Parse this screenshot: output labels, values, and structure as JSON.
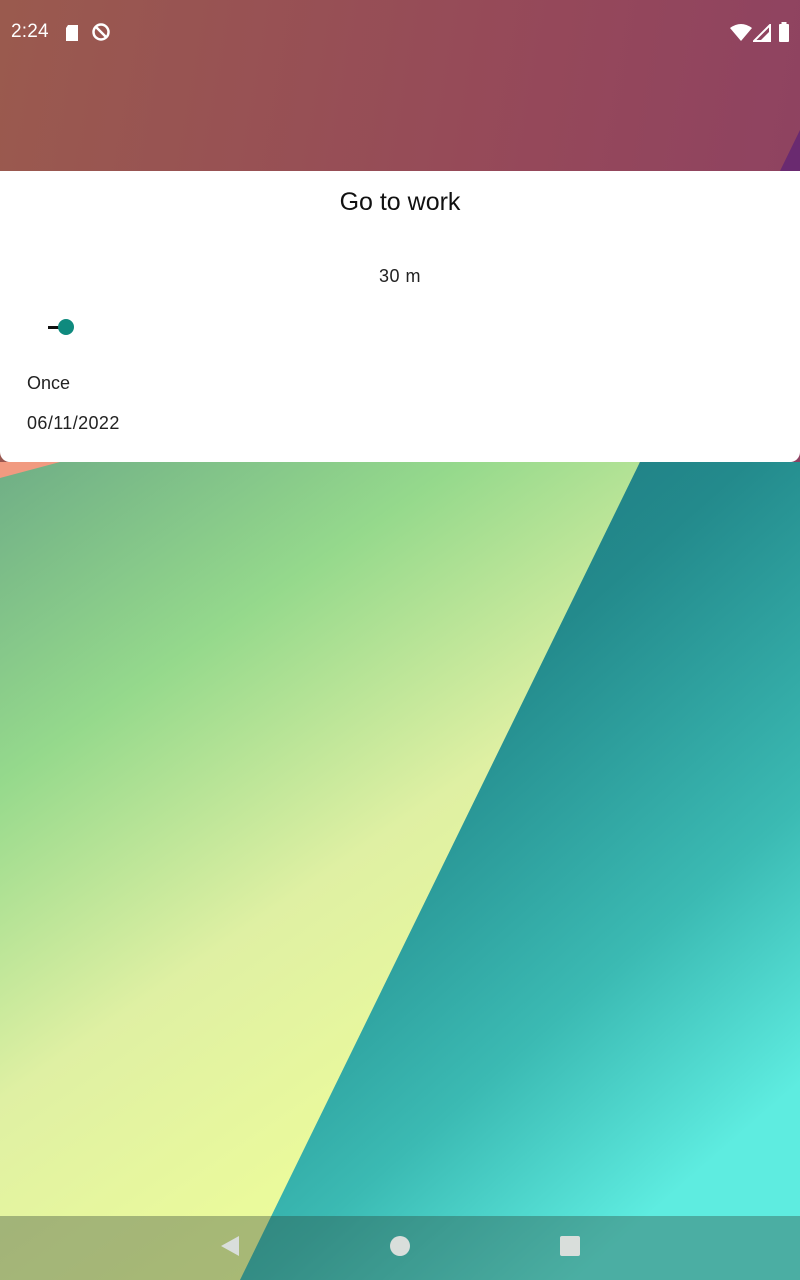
{
  "status_bar": {
    "time": "2:24",
    "left_icons": [
      "sd-card-icon",
      "data-saver-icon"
    ],
    "right_icons": [
      "wifi-icon",
      "signal-icon",
      "battery-icon"
    ]
  },
  "card": {
    "title": "Go to work",
    "duration": "30 m",
    "slider": {
      "value_fraction": 0.01
    },
    "repeat": "Once",
    "date": "06/11/2022"
  },
  "nav_bar": {
    "buttons": [
      "back-icon",
      "home-icon",
      "recents-icon"
    ]
  },
  "colors": {
    "accent": "#0f8a7e",
    "card_background": "#ffffff",
    "wallpaper_top": "#95485a",
    "wallpaper_green": "#8fd48a",
    "wallpaper_teal": "#2a9a98"
  }
}
